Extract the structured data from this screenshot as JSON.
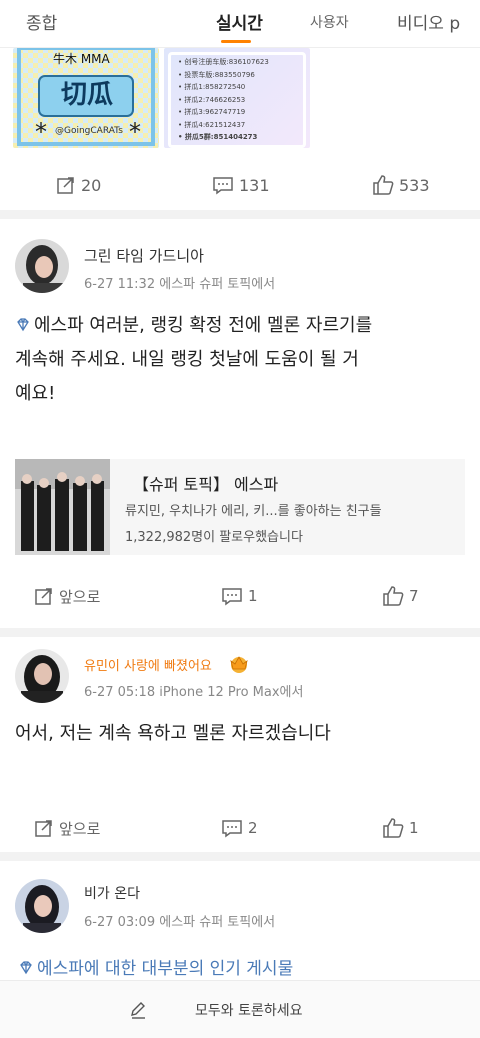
{
  "tabs": [
    {
      "label": "종합"
    },
    {
      "label": "실시간"
    },
    {
      "label": "사용자"
    },
    {
      "label": "비디오 p"
    }
  ],
  "colors": {
    "accent": "#ff8200",
    "vip_name": "#f07b12",
    "link": "#4a7ab7"
  },
  "post1": {
    "image1_text_top": "牛木 MMA",
    "image1_text_main": "切瓜",
    "image1_text_bottom": "@GoingCARATs",
    "image2_lines": [
      "创号注册车版:836107623",
      "投票车版:883550796",
      "拼瓜1:858272540",
      "拼瓜2:746626253",
      "拼瓜3:962747719",
      "拼瓜4:621512437",
      "拼瓜5群:851404273"
    ],
    "repost_count": "20",
    "comment_count": "131",
    "like_count": "533"
  },
  "post2": {
    "username": "그린 타임 가드니아",
    "meta": "6-27 11:32  에스파 슈퍼 토픽에서",
    "text_line1": "에스파 여러분, 랭킹 확정 전에 멜론 자르기를",
    "text_line2": "계속해 주세요. 내일 랭킹 첫날에 도움이 될 거",
    "text_line3": "예요!",
    "topic_title": "【슈퍼 토픽】   에스파",
    "topic_sub1": "류지민, 우치나가 에리, 키...를 좋아하는 친구들",
    "topic_sub2": "1,322,982명이 팔로우했습니다",
    "repost_label": "앞으로",
    "comment_count": "1",
    "like_count": "7"
  },
  "post3": {
    "username": "유민이 사랑에 빠졌어요",
    "meta": "6-27 05:18 iPhone 12 Pro Max에서",
    "text": "어서, 저는 계속 욕하고 멜론 자르겠습니다",
    "repost_label": "앞으로",
    "comment_count": "2",
    "like_count": "1"
  },
  "post4": {
    "username": "비가 온다",
    "meta": "6-27 03:09 에스파 슈퍼 토픽에서",
    "link_text": "에스파에 대한 대부분의 인기 게시물"
  },
  "bottom": {
    "label": "모두와 토론하세요"
  },
  "icons": [
    "repost-icon",
    "comment-icon",
    "like-icon",
    "diamond-icon",
    "crown-badge-icon",
    "edit-pencil-icon"
  ]
}
